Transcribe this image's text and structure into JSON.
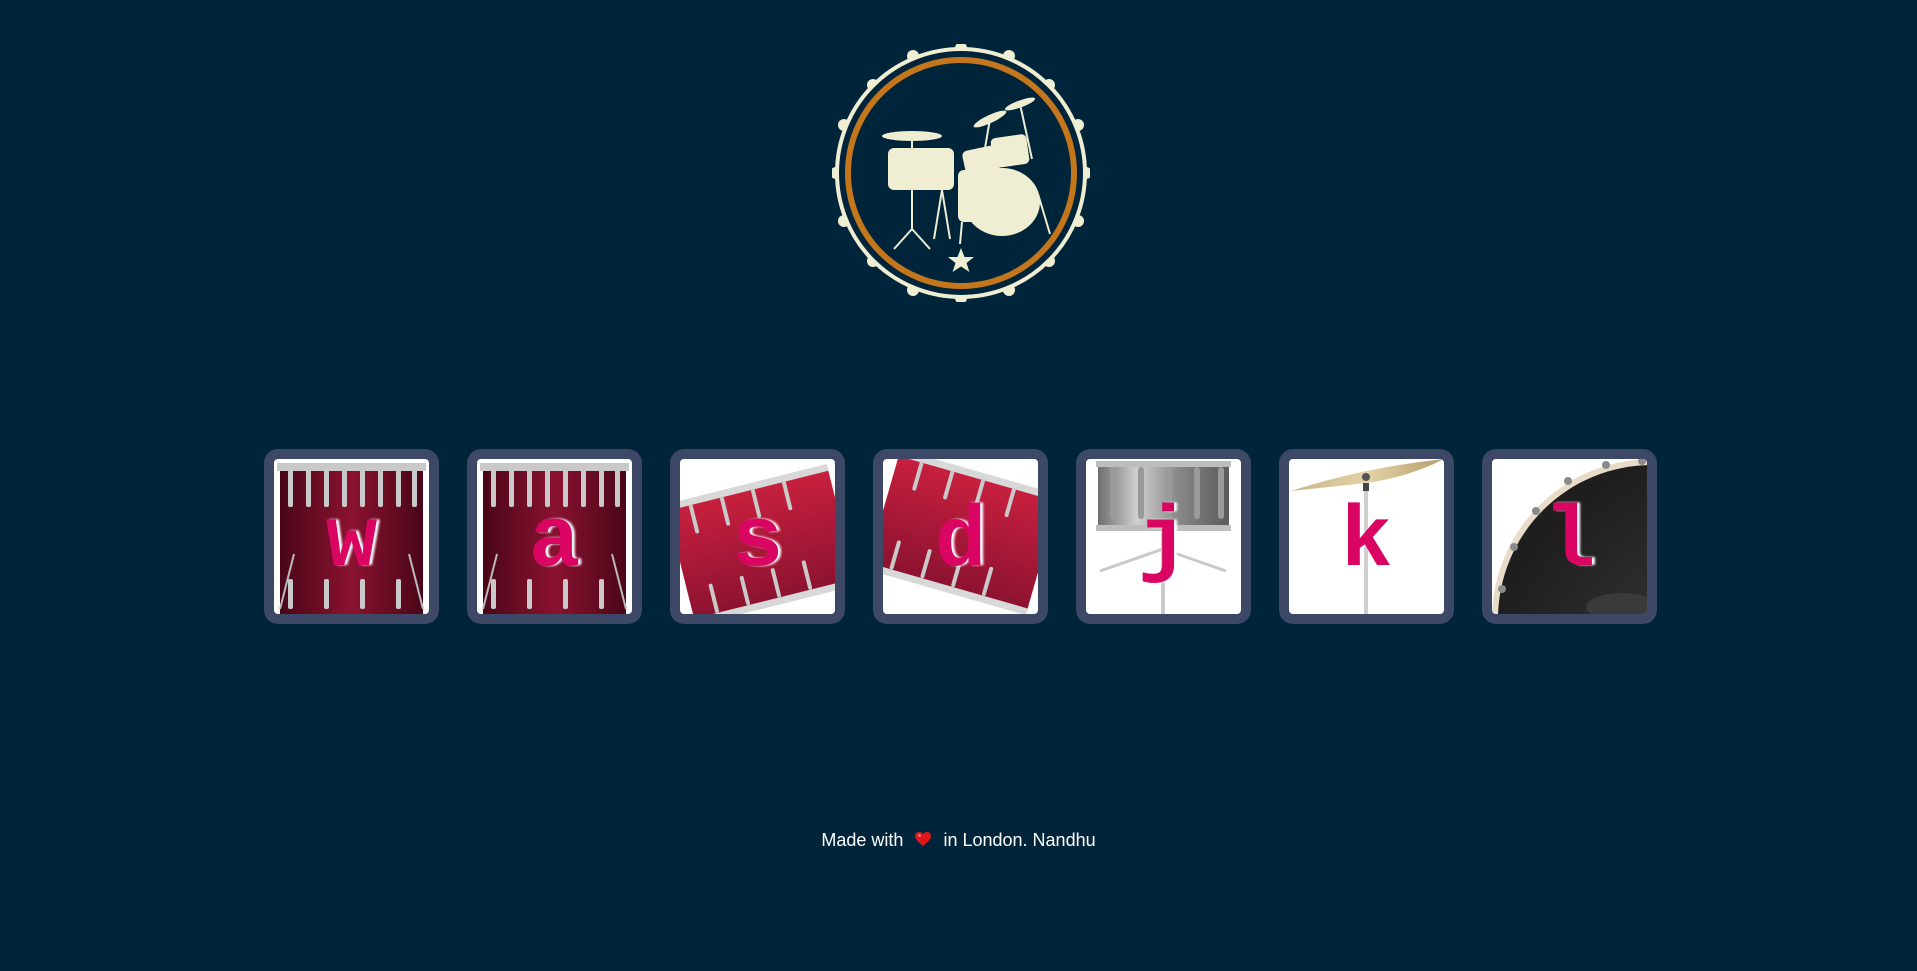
{
  "drums": [
    {
      "key": "w",
      "icon": "tom1-drum-icon"
    },
    {
      "key": "a",
      "icon": "tom2-drum-icon"
    },
    {
      "key": "s",
      "icon": "tom3-drum-icon"
    },
    {
      "key": "d",
      "icon": "tom4-drum-icon"
    },
    {
      "key": "j",
      "icon": "snare-drum-icon"
    },
    {
      "key": "k",
      "icon": "crash-cymbal-icon"
    },
    {
      "key": "l",
      "icon": "kick-drum-icon"
    }
  ],
  "footer": {
    "before": "Made with",
    "after": "in London. Nandhu",
    "heart_icon": "heart-icon"
  },
  "logo": {
    "icon": "drum-kit-logo-icon"
  },
  "colors": {
    "background": "#00253b",
    "button_frame": "#3d4766",
    "key_letter": "#da0463",
    "logo_cream": "#f0eed2",
    "logo_ring": "#c4761c"
  }
}
